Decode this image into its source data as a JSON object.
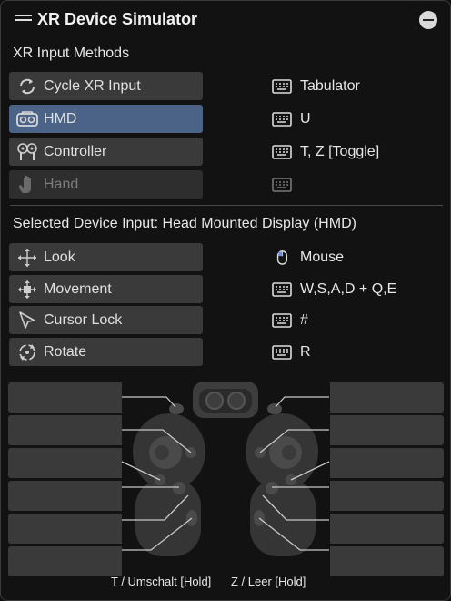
{
  "window": {
    "title": "XR Device Simulator"
  },
  "input_methods": {
    "heading": "XR Input Methods",
    "items": [
      {
        "label": "Cycle XR Input",
        "shortcut": "Tabulator",
        "icon": "cycle-icon",
        "state": "normal"
      },
      {
        "label": "HMD",
        "shortcut": "U",
        "icon": "hmd-icon",
        "state": "active"
      },
      {
        "label": "Controller",
        "shortcut": "T, Z [Toggle]",
        "icon": "controller-icon",
        "state": "normal"
      },
      {
        "label": "Hand",
        "shortcut": "",
        "icon": "hand-icon",
        "state": "disabled"
      }
    ]
  },
  "device_input": {
    "heading": "Selected Device Input: Head Mounted Display (HMD)",
    "items": [
      {
        "label": "Look",
        "shortcut": "Mouse",
        "icon": "look-icon",
        "shortcut_icon": "mouse-icon"
      },
      {
        "label": "Movement",
        "shortcut": "W,S,A,D + Q,E",
        "icon": "movement-icon",
        "shortcut_icon": "keyboard-icon"
      },
      {
        "label": "Cursor Lock",
        "shortcut": "#",
        "icon": "cursor-lock-icon",
        "shortcut_icon": "keyboard-icon"
      },
      {
        "label": "Rotate",
        "shortcut": "R",
        "icon": "rotate-icon",
        "shortcut_icon": "keyboard-icon"
      }
    ]
  },
  "controllers": {
    "left_hint": "T / Umschalt [Hold]",
    "right_hint": "Z / Leer [Hold]"
  },
  "colors": {
    "active": "#4a6386",
    "button": "#3a3a3a",
    "background": "#121212"
  }
}
